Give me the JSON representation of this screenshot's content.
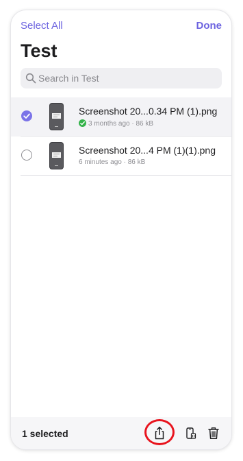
{
  "nav": {
    "select_all_label": "Select All",
    "done_label": "Done"
  },
  "title": "Test",
  "search": {
    "placeholder": "Search in Test",
    "value": ""
  },
  "files": [
    {
      "name": "Screenshot 20...0.34 PM (1).png",
      "age": "3 months ago",
      "size": "86 kB",
      "selected": true,
      "synced": true
    },
    {
      "name": "Screenshot 20...4 PM (1)(1).png",
      "age": "6 minutes ago",
      "size": "86 kB",
      "selected": false,
      "synced": false
    }
  ],
  "toolbar": {
    "selected_text": "1 selected",
    "actions": [
      "share-icon",
      "move-to-phone-icon",
      "trash-icon"
    ]
  },
  "colors": {
    "accent": "#6c63e0",
    "checked": "#7b73e8",
    "synced": "#34b24a",
    "highlight": "#e8141e"
  }
}
